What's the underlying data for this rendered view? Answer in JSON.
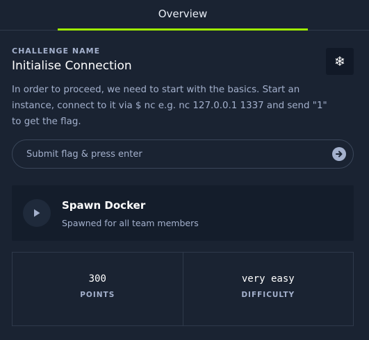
{
  "tabs": [
    {
      "label": "Overview",
      "active": true
    }
  ],
  "colors": {
    "accent": "#9fef00",
    "background": "#1a2332",
    "panel": "#141d2b",
    "muted": "#a4b1cd"
  },
  "challenge": {
    "category_label": "CHALLENGE NAME",
    "title": "Initialise Connection",
    "icon": "snowflake-icon",
    "description": "In order to proceed, we need to start with the basics. Start an instance, connect to it via $ nc e.g. nc 127.0.0.1 1337 and send \"1\" to get the flag."
  },
  "flag_input": {
    "placeholder": "Submit flag & press enter",
    "value": "",
    "submit_icon": "arrow-right-icon"
  },
  "docker": {
    "title": "Spawn Docker",
    "subtitle": "Spawned for all team members",
    "icon": "play-icon"
  },
  "stats": [
    {
      "value": "300",
      "label": "POINTS"
    },
    {
      "value": "very easy",
      "label": "DIFFICULTY"
    }
  ]
}
